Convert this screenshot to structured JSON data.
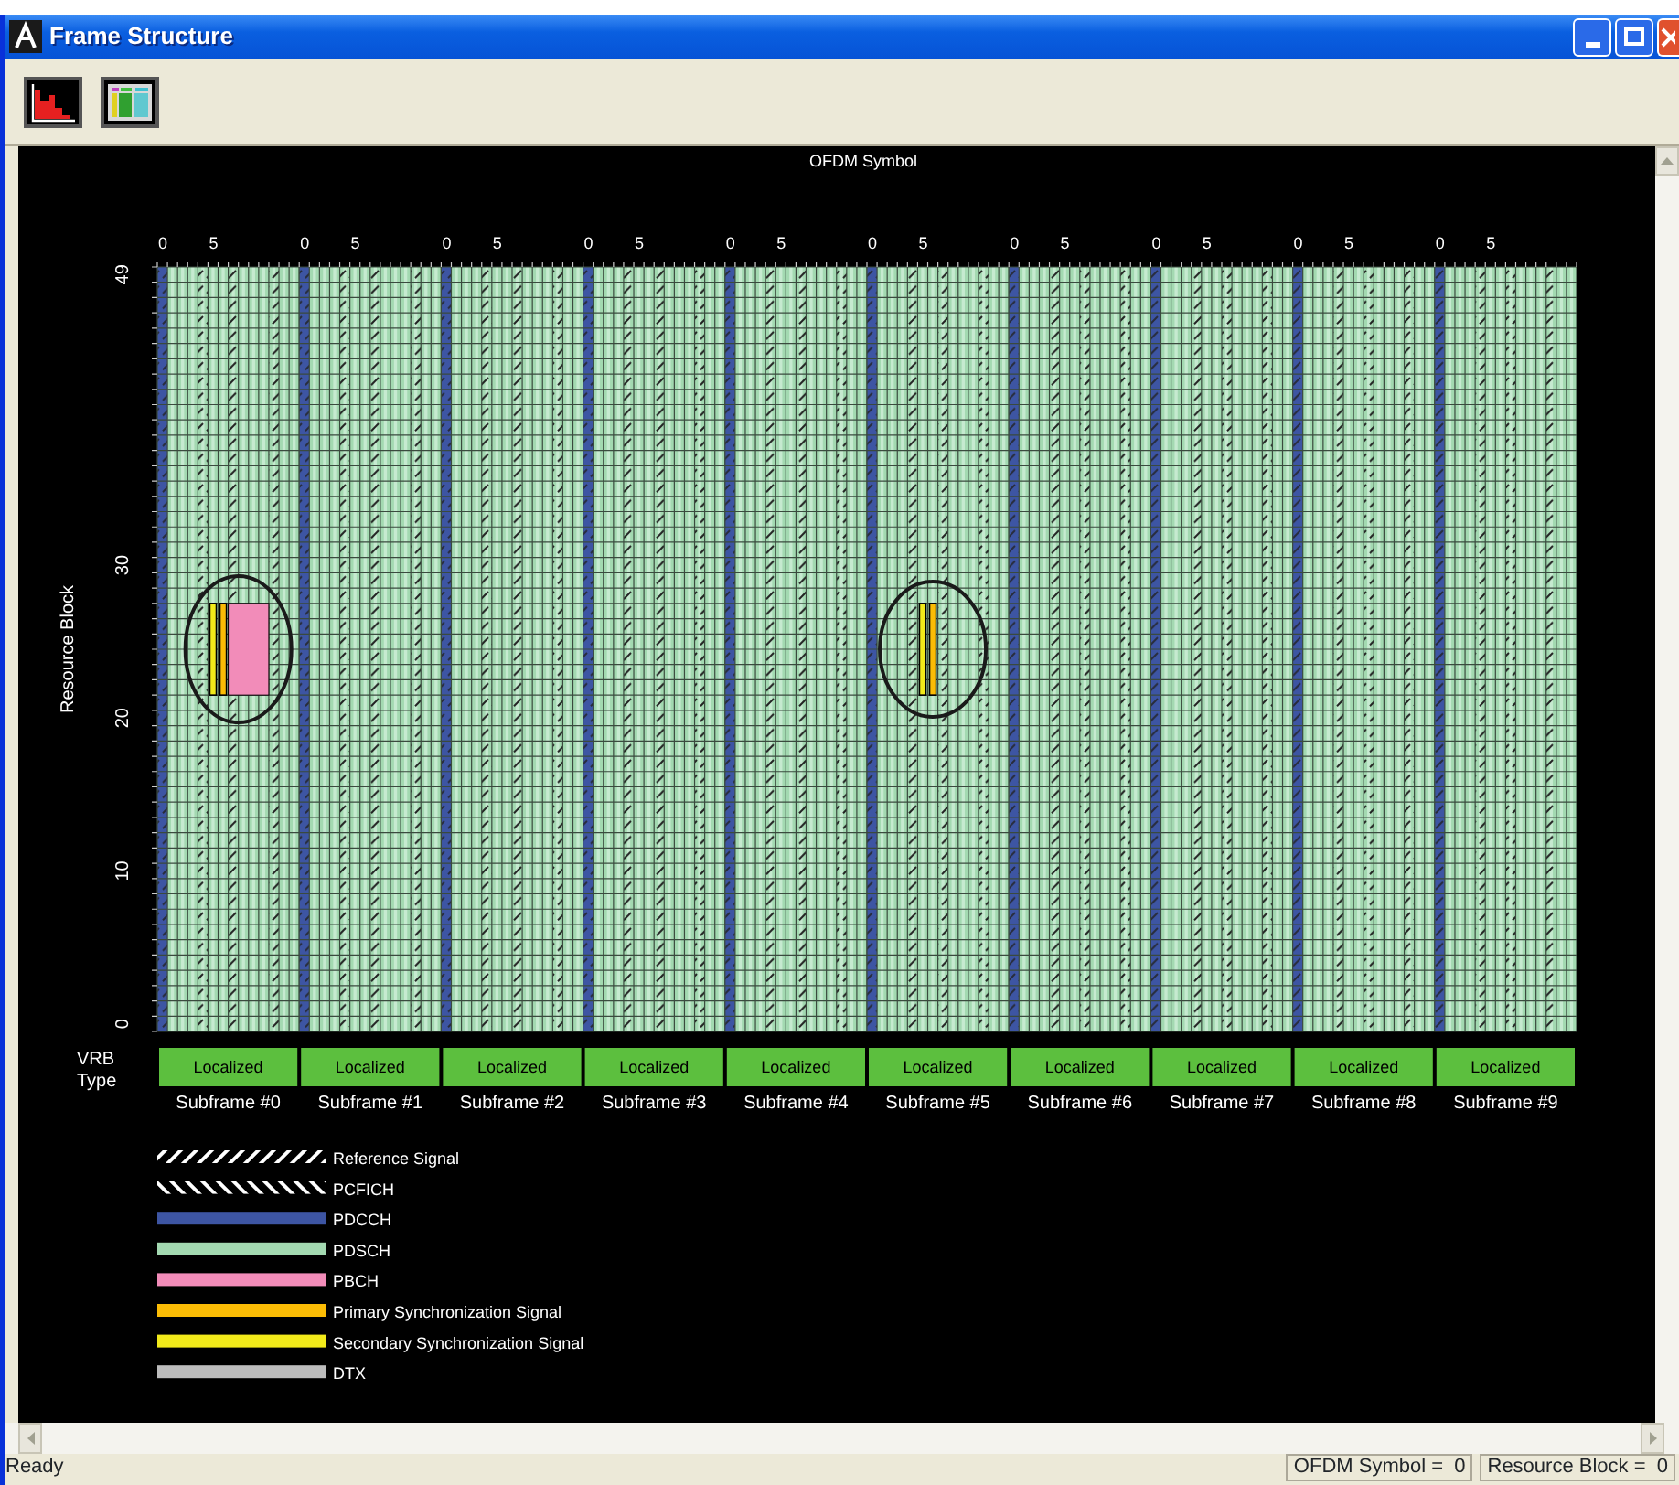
{
  "window": {
    "title": "Frame Structure"
  },
  "chart": {
    "x_axis_title": "OFDM Symbol",
    "y_axis_title": "Resource Block",
    "y_ticks": [
      "0",
      "10",
      "20",
      "30",
      "49"
    ],
    "row_label": "VRB Type",
    "subframes": [
      {
        "label": "Subframe #0",
        "vrb_type": "Localized",
        "symbol_ticks": [
          "0",
          "5"
        ],
        "sync_signals": true,
        "pbch": true
      },
      {
        "label": "Subframe #1",
        "vrb_type": "Localized",
        "symbol_ticks": [
          "0",
          "5"
        ],
        "sync_signals": false,
        "pbch": false
      },
      {
        "label": "Subframe #2",
        "vrb_type": "Localized",
        "symbol_ticks": [
          "0",
          "5"
        ],
        "sync_signals": false,
        "pbch": false
      },
      {
        "label": "Subframe #3",
        "vrb_type": "Localized",
        "symbol_ticks": [
          "0",
          "5"
        ],
        "sync_signals": false,
        "pbch": false
      },
      {
        "label": "Subframe #4",
        "vrb_type": "Localized",
        "symbol_ticks": [
          "0",
          "5"
        ],
        "sync_signals": false,
        "pbch": false
      },
      {
        "label": "Subframe #5",
        "vrb_type": "Localized",
        "symbol_ticks": [
          "0",
          "5"
        ],
        "sync_signals": true,
        "pbch": false
      },
      {
        "label": "Subframe #6",
        "vrb_type": "Localized",
        "symbol_ticks": [
          "0",
          "5"
        ],
        "sync_signals": false,
        "pbch": false
      },
      {
        "label": "Subframe #7",
        "vrb_type": "Localized",
        "symbol_ticks": [
          "0",
          "5"
        ],
        "sync_signals": false,
        "pbch": false
      },
      {
        "label": "Subframe #8",
        "vrb_type": "Localized",
        "symbol_ticks": [
          "0",
          "5"
        ],
        "sync_signals": false,
        "pbch": false
      },
      {
        "label": "Subframe #9",
        "vrb_type": "Localized",
        "symbol_ticks": [
          "0",
          "5"
        ],
        "sync_signals": false,
        "pbch": false
      }
    ]
  },
  "legend": [
    {
      "label": "Reference Signal",
      "kind": "hatch",
      "color": "#ffffff"
    },
    {
      "label": "PCFICH",
      "kind": "backhatch",
      "color": "#ffffff"
    },
    {
      "label": "PDCCH",
      "kind": "solid",
      "color": "#3d55a3"
    },
    {
      "label": "PDSCH",
      "kind": "solid",
      "color": "#a3d9b1"
    },
    {
      "label": "PBCH",
      "kind": "solid",
      "color": "#f28cb9"
    },
    {
      "label": "Primary Synchronization Signal",
      "kind": "solid",
      "color": "#fbbc05"
    },
    {
      "label": "Secondary Synchronization Signal",
      "kind": "solid",
      "color": "#f2ea1a"
    },
    {
      "label": "DTX",
      "kind": "solid",
      "color": "#bdbdbd"
    }
  ],
  "status_bar": {
    "message": "Ready",
    "panels": [
      "OFDM Symbol =  0",
      "Resource Block =  0"
    ]
  }
}
